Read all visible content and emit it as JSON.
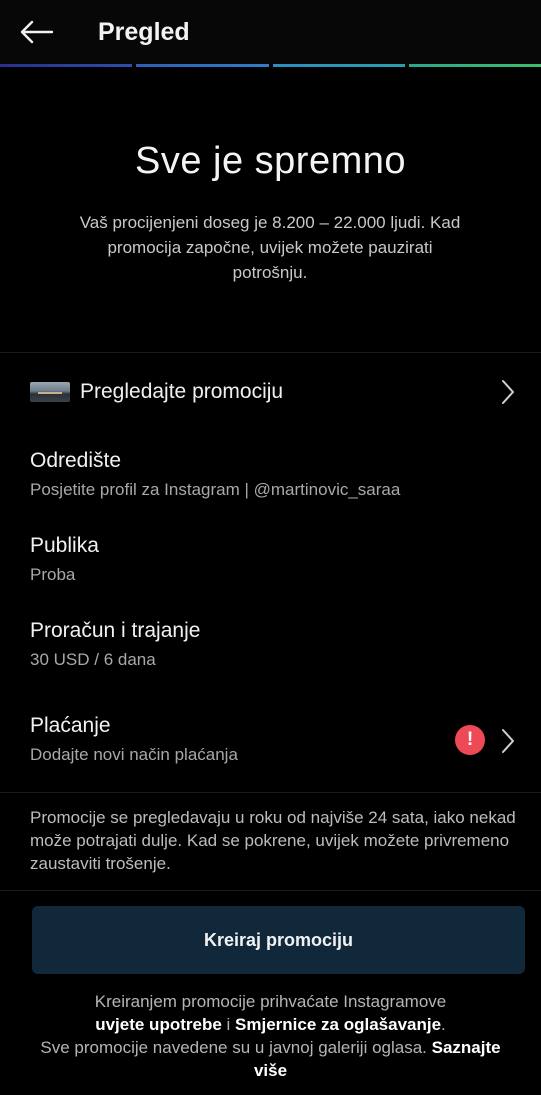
{
  "header": {
    "title": "Pregled",
    "back_icon": "arrow-left-icon"
  },
  "progress": {
    "steps": 4,
    "colors": [
      "#2a2f8e",
      "#2c5fb8",
      "#2c8fbf",
      "#3dbe6c"
    ]
  },
  "hero": {
    "title": "Sve je spremno",
    "description": "Vaš procijenjeni doseg je 8.200 – 22.000 ljudi. Kad promocija započne, uvijek možete pauzirati potrošnju."
  },
  "review": {
    "label": "Pregledajte promociju",
    "icon": "chevron-right-icon"
  },
  "destination": {
    "title": "Odredište",
    "value": "Posjetite profil za Instagram | @martinovic_saraa"
  },
  "audience": {
    "title": "Publika",
    "value": "Proba"
  },
  "budget": {
    "title": "Proračun i trajanje",
    "value": "30 USD / 6 dana"
  },
  "payment": {
    "title": "Plaćanje",
    "value": "Dodajte novi način plaćanja",
    "warning_symbol": "!",
    "warning_color": "#ed4956"
  },
  "info": {
    "text": "Promocije se pregledavaju u roku od najviše 24 sata, iako nekad može potrajati dulje. Kad se pokrene, uvijek možete privremeno zaustaviti trošenje."
  },
  "cta": {
    "label": "Kreiraj promociju",
    "color": "#11283a"
  },
  "legal": {
    "prefix": "Kreiranjem promocije prihvaćate Instagramove",
    "terms_link": "uvjete upotrebe",
    "connector": "i",
    "guidelines_link": "Smjernice za oglašavanje",
    "period": ".",
    "middle": "Sve promocije navedene su u javnoj galeriji oglasa.",
    "learn_more": "Saznajte više"
  }
}
